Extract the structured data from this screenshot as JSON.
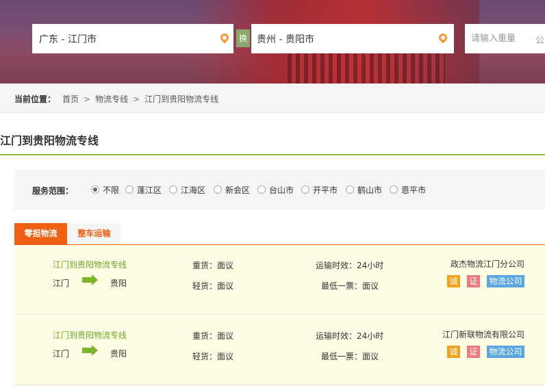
{
  "search": {
    "from": "广东 - 江门市",
    "swap_label": "换",
    "to": "贵州 - 贵阳市",
    "weight_placeholder": "请输入重量",
    "weight_unit": "公"
  },
  "breadcrumb": {
    "label": "当前位置：",
    "items": [
      "首页",
      "物流专线",
      "江门到贵阳物流专线"
    ],
    "sep": ">"
  },
  "page_title": "江门到贵阳物流专线",
  "filter": {
    "label": "服务范围：",
    "options": [
      "不限",
      "蓬江区",
      "江海区",
      "新会区",
      "台山市",
      "开平市",
      "鹤山市",
      "恩平市"
    ],
    "selected": "不限"
  },
  "tabs": [
    "零担物流",
    "整车运输"
  ],
  "listings": [
    {
      "route": "江门到贵阳物流专线",
      "from": "江门",
      "to": "贵阳",
      "heavy": "重货：面议",
      "light": "轻货：面议",
      "time": "运输时效：24小时",
      "min": "最低一票：面议",
      "company": "政杰物流江门分公司",
      "badges": [
        "诚",
        "证",
        "物流公司"
      ]
    },
    {
      "route": "江门到贵阳物流专线",
      "from": "江门",
      "to": "贵阳",
      "heavy": "重货：面议",
      "light": "轻货：面议",
      "time": "运输时效：24小时",
      "min": "最低一票：面议",
      "company": "江门新联物流有限公司",
      "badges": [
        "诚",
        "证",
        "物流公司"
      ]
    }
  ]
}
